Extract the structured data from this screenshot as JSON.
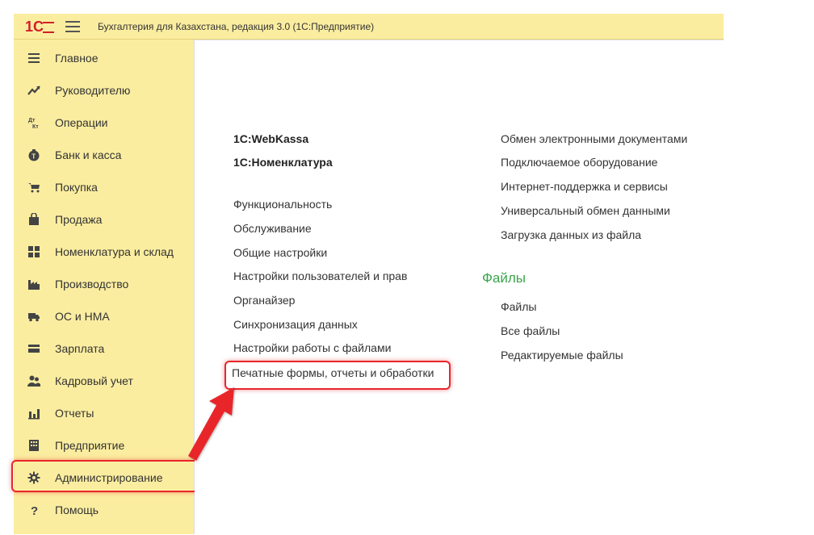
{
  "header": {
    "title": "Бухгалтерия для Казахстана, редакция 3.0  (1С:Предприятие)",
    "logo_color": "#d11e2a"
  },
  "sidebar": {
    "items": [
      {
        "label": "Главное",
        "icon": "menu-lines-icon"
      },
      {
        "label": "Руководителю",
        "icon": "trend-icon"
      },
      {
        "label": "Операции",
        "icon": "dt-kt-icon"
      },
      {
        "label": "Банк и касса",
        "icon": "money-bag-icon"
      },
      {
        "label": "Покупка",
        "icon": "cart-icon"
      },
      {
        "label": "Продажа",
        "icon": "shopping-bag-icon"
      },
      {
        "label": "Номенклатура и склад",
        "icon": "grid-icon"
      },
      {
        "label": "Производство",
        "icon": "factory-icon"
      },
      {
        "label": "ОС и НМА",
        "icon": "truck-icon"
      },
      {
        "label": "Зарплата",
        "icon": "wallet-icon"
      },
      {
        "label": "Кадровый учет",
        "icon": "people-icon"
      },
      {
        "label": "Отчеты",
        "icon": "bar-chart-icon"
      },
      {
        "label": "Предприятие",
        "icon": "building-icon"
      },
      {
        "label": "Администрирование",
        "icon": "gear-icon"
      },
      {
        "label": "Помощь",
        "icon": "question-icon"
      }
    ]
  },
  "main": {
    "left_top_links": [
      "1С:WebKassa",
      "1С:Номенклатура"
    ],
    "left_links": [
      "Функциональность",
      "Обслуживание",
      "Общие настройки",
      "Настройки пользователей и прав",
      "Органайзер",
      "Синхронизация данных",
      "Настройки работы с файлами",
      "Печатные формы, отчеты и обработки"
    ],
    "right_links": [
      "Обмен электронными документами",
      "Подключаемое оборудование",
      "Интернет-поддержка и сервисы",
      "Универсальный обмен данными",
      "Загрузка данных из файла"
    ],
    "files_section": {
      "title": "Файлы",
      "links": [
        "Файлы",
        "Все файлы",
        "Редактируемые файлы"
      ]
    }
  },
  "colors": {
    "sidebar_bg": "#fbeda0",
    "section_title": "#3aa44b",
    "highlight": "#e8262c"
  }
}
